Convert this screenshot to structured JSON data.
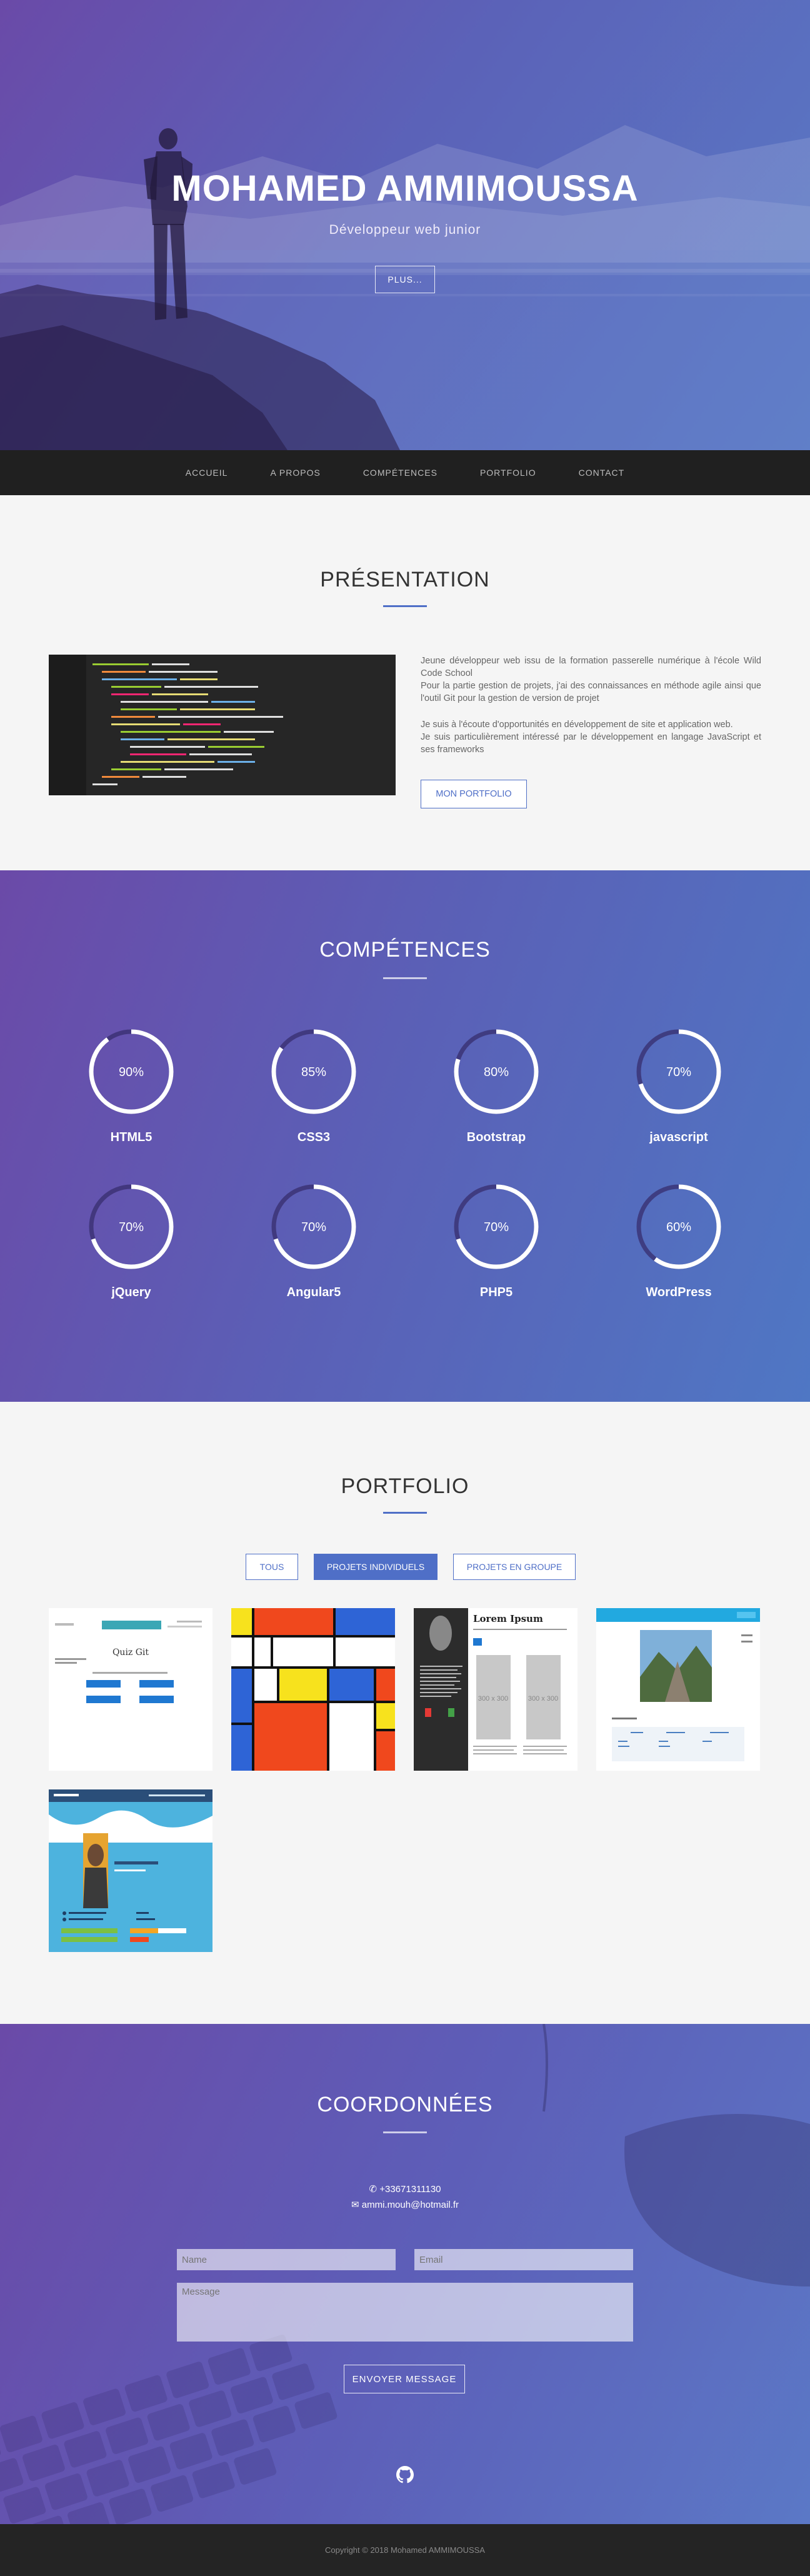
{
  "hero": {
    "title": "MOHAMED AMMIMOUSSA",
    "subtitle": "Développeur web junior",
    "button": "PLUS..."
  },
  "nav": {
    "items": [
      {
        "label": "ACCUEIL"
      },
      {
        "label": "A PROPOS"
      },
      {
        "label": "COMPÉTENCES"
      },
      {
        "label": "PORTFOLIO"
      },
      {
        "label": "CONTACT"
      }
    ]
  },
  "presentation": {
    "title": "PRÉSENTATION",
    "paragraph1": "Jeune développeur web issu de la formation passerelle numérique à l'école Wild Code School",
    "paragraph2": "Pour la partie gestion de projets, j'ai des connaissances en méthode agile ainsi que l'outil Git pour la gestion de version de projet",
    "paragraph3": "Je suis à l'écoute d'opportunités en développement de site et application web.",
    "paragraph4": "Je suis particulièrement intéressé par le développement en langage JavaScript et ses frameworks",
    "button": "MON PORTFOLIO"
  },
  "skills": {
    "title": "COMPÉTENCES",
    "items": [
      {
        "name": "HTML5",
        "value": 90,
        "label": "90%"
      },
      {
        "name": "CSS3",
        "value": 85,
        "label": "85%"
      },
      {
        "name": "Bootstrap",
        "value": 80,
        "label": "80%"
      },
      {
        "name": "javascript",
        "value": 70,
        "label": "70%"
      },
      {
        "name": "jQuery",
        "value": 70,
        "label": "70%"
      },
      {
        "name": "Angular5",
        "value": 70,
        "label": "70%"
      },
      {
        "name": "PHP5",
        "value": 70,
        "label": "70%"
      },
      {
        "name": "WordPress",
        "value": 60,
        "label": "60%"
      }
    ]
  },
  "portfolio": {
    "title": "PORTFOLIO",
    "filters": [
      {
        "label": "TOUS"
      },
      {
        "label": "PROJETS INDIVIDUELS"
      },
      {
        "label": "PROJETS EN GROUPE"
      }
    ],
    "thumbs": {
      "quiz_title": "Quiz Git",
      "lorem_title": "Lorem Ipsum",
      "ph1": "300 x 300",
      "ph2": "300 x 300"
    }
  },
  "contact": {
    "title": "COORDONNÉES",
    "phone": "+33671311130",
    "email": "ammi.mouh@hotmail.fr",
    "name_placeholder": "Name",
    "email_placeholder": "Email",
    "message_placeholder": "Message",
    "button": "ENVOYER MESSAGE"
  },
  "footer": {
    "text": "Copyright © 2018 Mohamed AMMIMOUSSA"
  },
  "colors": {
    "accent": "#4f6fc7",
    "purple": "#6a4aa8",
    "blue": "#5a7bc6",
    "nav_bg": "#202020",
    "footer_bg": "#242424"
  }
}
